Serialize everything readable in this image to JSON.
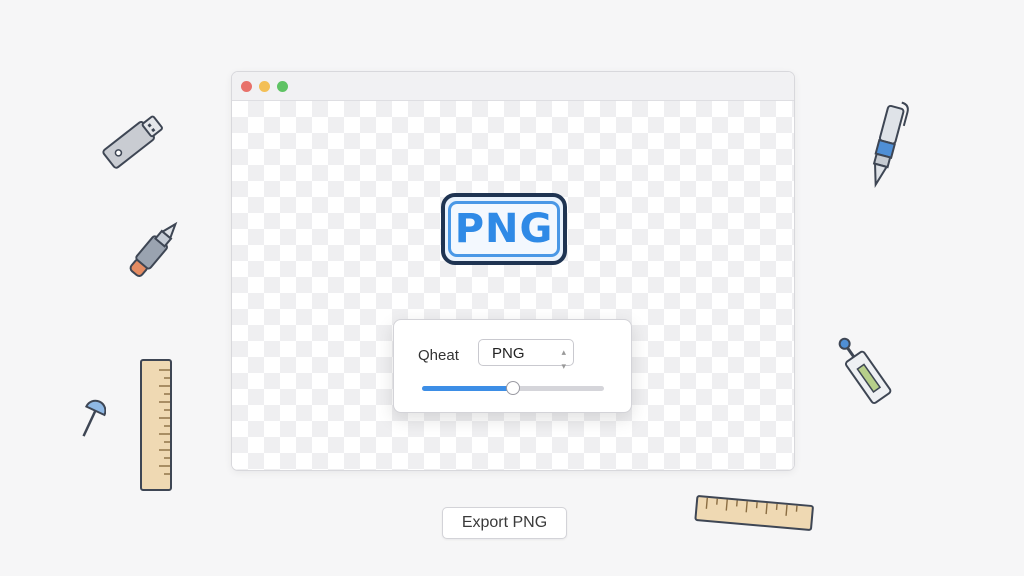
{
  "window": {
    "controls": [
      "close",
      "minimize",
      "zoom"
    ],
    "control_colors": {
      "close": "#e8716a",
      "minimize": "#f3bf56",
      "zoom": "#5fc364"
    }
  },
  "preview": {
    "badge_text": "PNG",
    "badge_color": "#2f8ae6",
    "background": "transparent-checkerboard"
  },
  "export_panel": {
    "format_label": "Qheat",
    "format_value": "PNG",
    "format_arrow_icon": "updown-chevron-icon",
    "quality_slider_fraction": 0.5
  },
  "export_button": {
    "label": "Export PNG"
  },
  "decorations": [
    "usb-drive-icon",
    "marker-pen-icon",
    "ruler-icon",
    "pushpin-icon",
    "technical-pen-icon",
    "tester-probe-icon",
    "ruler-icon"
  ]
}
